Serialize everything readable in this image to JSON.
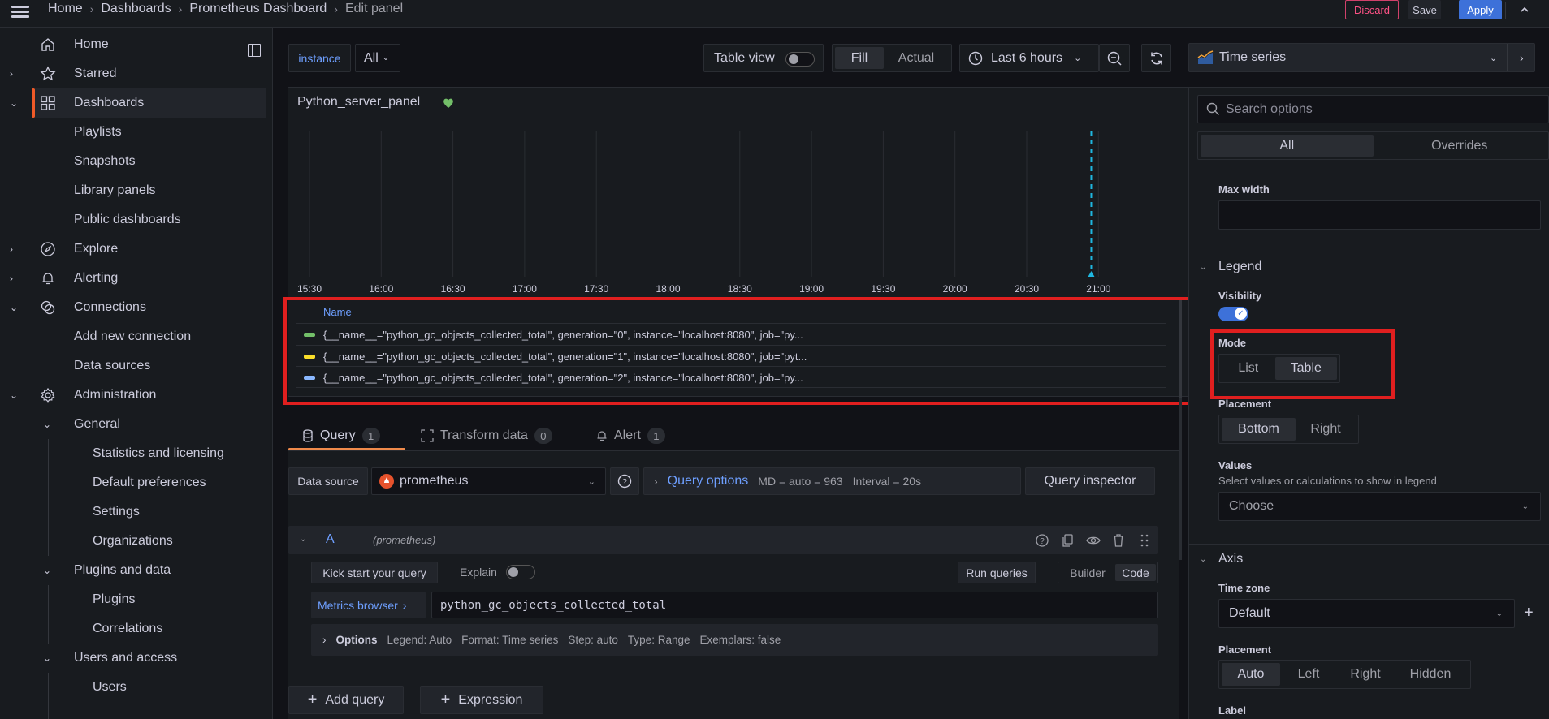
{
  "topbar": {
    "breadcrumb": [
      "Home",
      "Dashboards",
      "Prometheus Dashboard",
      "Edit panel"
    ],
    "discard_label": "Discard",
    "save_label": "Save",
    "apply_label": "Apply"
  },
  "sidebar": {
    "items": [
      {
        "label": "Home",
        "icon": "home-icon"
      },
      {
        "label": "Starred",
        "icon": "star-icon"
      },
      {
        "label": "Dashboards",
        "icon": "dashboards-icon"
      },
      {
        "label": "Playlists"
      },
      {
        "label": "Snapshots"
      },
      {
        "label": "Library panels"
      },
      {
        "label": "Public dashboards"
      },
      {
        "label": "Explore",
        "icon": "compass-icon"
      },
      {
        "label": "Alerting",
        "icon": "bell-icon"
      },
      {
        "label": "Connections",
        "icon": "connections-icon"
      },
      {
        "label": "Add new connection"
      },
      {
        "label": "Data sources"
      },
      {
        "label": "Administration",
        "icon": "gear-icon"
      },
      {
        "label": "General"
      },
      {
        "label": "Statistics and licensing"
      },
      {
        "label": "Default preferences"
      },
      {
        "label": "Settings"
      },
      {
        "label": "Organizations"
      },
      {
        "label": "Plugins and data"
      },
      {
        "label": "Plugins"
      },
      {
        "label": "Correlations"
      },
      {
        "label": "Users and access"
      },
      {
        "label": "Users"
      }
    ]
  },
  "toolbar": {
    "variable_label": "instance",
    "variable_value": "All",
    "table_view_label": "Table view",
    "fill_label": "Fill",
    "actual_label": "Actual",
    "time_range": "Last 6 hours"
  },
  "panel": {
    "title": "Python_server_panel",
    "legend_header": "Name",
    "legend": [
      {
        "name": "{__name__=\"python_gc_objects_collected_total\", generation=\"0\", instance=\"localhost:8080\", job=\"py...",
        "color": "#73bf69"
      },
      {
        "name": "{__name__=\"python_gc_objects_collected_total\", generation=\"1\", instance=\"localhost:8080\", job=\"pyt...",
        "color": "#fade2a"
      },
      {
        "name": "{__name__=\"python_gc_objects_collected_total\", generation=\"2\", instance=\"localhost:8080\", job=\"py...",
        "color": "#8ab8ff"
      }
    ]
  },
  "chart_data": {
    "type": "line",
    "title": "Python_server_panel",
    "x_tick_labels": [
      "15:30",
      "16:00",
      "16:30",
      "17:00",
      "17:30",
      "18:00",
      "18:30",
      "19:00",
      "19:30",
      "20:00",
      "20:30",
      "21:00"
    ],
    "series": [
      {
        "name": "generation=\"0\"",
        "values": []
      },
      {
        "name": "generation=\"1\"",
        "values": []
      },
      {
        "name": "generation=\"2\"",
        "values": []
      }
    ],
    "annotation_time": "20:57",
    "grid": true
  },
  "query_tabs": [
    {
      "label": "Query",
      "count": "1"
    },
    {
      "label": "Transform data",
      "count": "0"
    },
    {
      "label": "Alert",
      "count": "1"
    }
  ],
  "query": {
    "datasource_label": "Data source",
    "datasource": "prometheus",
    "options_title": "Query options",
    "md": "MD = auto = 963",
    "interval": "Interval = 20s",
    "inspector_label": "Query inspector",
    "ref_id": "A",
    "ref_ds": "(prometheus)",
    "kickstart_label": "Kick start your query",
    "explain_label": "Explain",
    "run_label": "Run queries",
    "builder_label": "Builder",
    "code_label": "Code",
    "metrics_browser_label": "Metrics browser",
    "expr": "python_gc_objects_collected_total",
    "options_label": "Options",
    "options_summary": [
      "Legend: Auto",
      "Format: Time series",
      "Step: auto",
      "Type: Range",
      "Exemplars: false"
    ],
    "add_query_label": "Add query",
    "expression_label": "Expression"
  },
  "options_pane": {
    "viz_type": "Time series",
    "search_placeholder": "Search options",
    "tab_all": "All",
    "tab_overrides": "Overrides",
    "max_width_label": "Max width",
    "max_width_value": "",
    "legend_section": "Legend",
    "visibility_label": "Visibility",
    "visibility_on": true,
    "mode_label": "Mode",
    "mode_options": [
      "List",
      "Table"
    ],
    "mode_selected": "Table",
    "placement_label": "Placement",
    "placement_options": [
      "Bottom",
      "Right"
    ],
    "placement_selected": "Bottom",
    "values_label": "Values",
    "values_desc": "Select values or calculations to show in legend",
    "values_placeholder": "Choose",
    "axis_section": "Axis",
    "timezone_label": "Time zone",
    "timezone_value": "Default",
    "axis_placement_label": "Placement",
    "axis_placement_options": [
      "Auto",
      "Left",
      "Right",
      "Hidden"
    ],
    "axis_placement_selected": "Auto",
    "label_label": "Label"
  }
}
